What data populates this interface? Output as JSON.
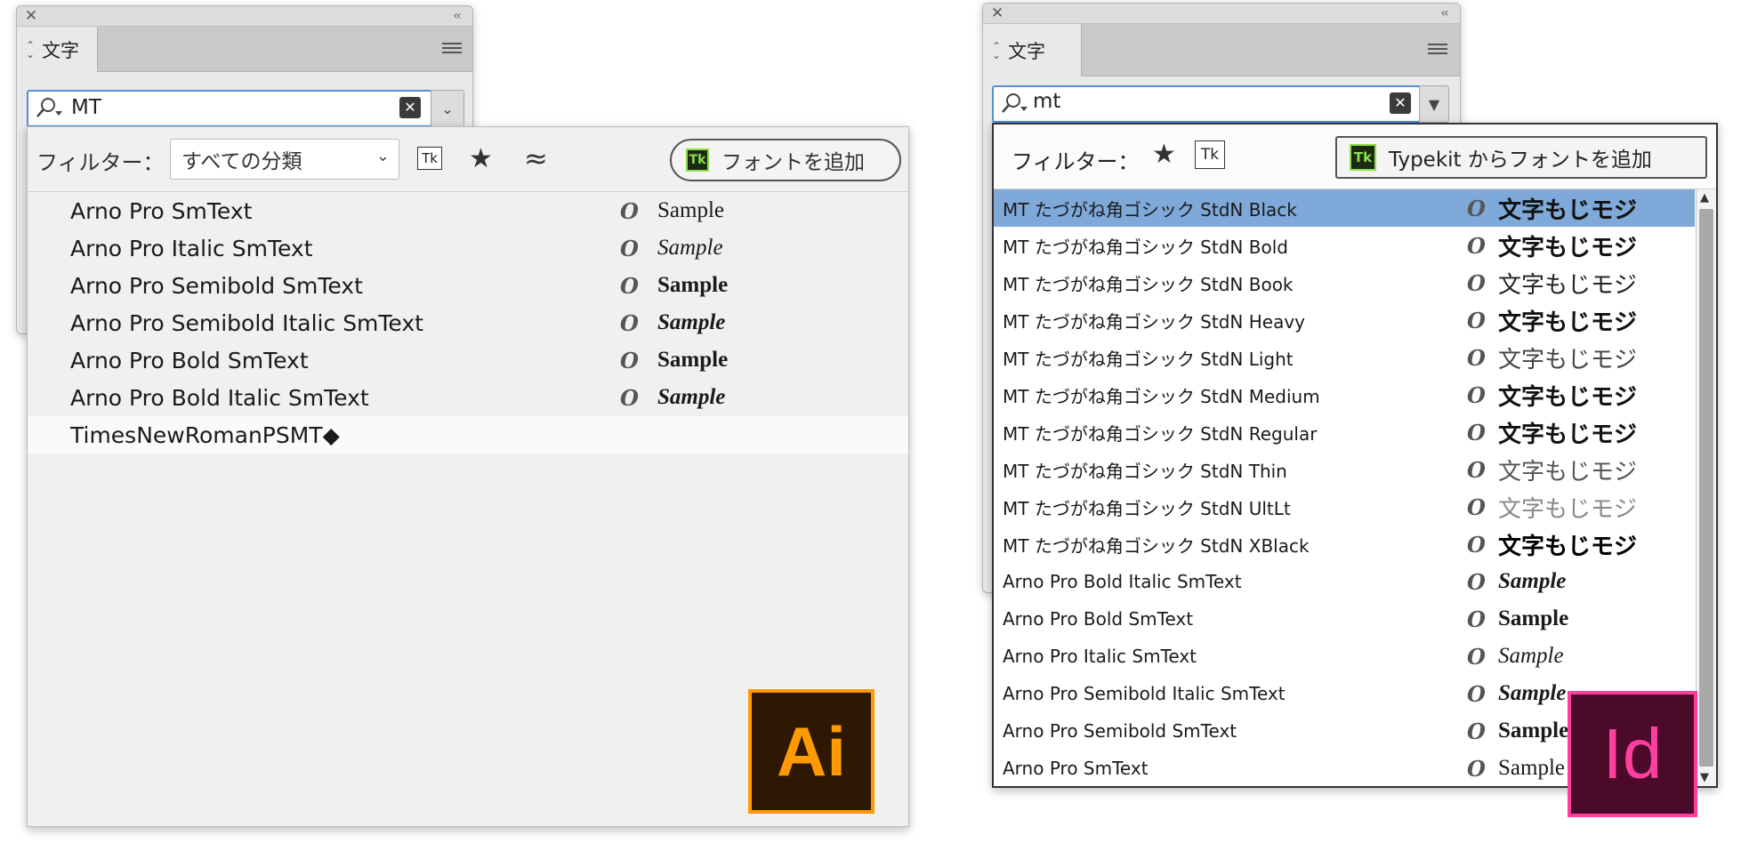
{
  "left_panel": {
    "tab_label": "文字",
    "search_value": "MT",
    "filter_label": "フィルター：",
    "classification_select": "すべての分類",
    "tk_label": "Tk",
    "add_font_button": "フォントを追加",
    "fonts": [
      {
        "name": "Arno Pro SmText",
        "sample": "Sample"
      },
      {
        "name": "Arno Pro Italic SmText",
        "sample": "Sample"
      },
      {
        "name": "Arno Pro Semibold SmText",
        "sample": "Sample"
      },
      {
        "name": "Arno Pro Semibold Italic SmText",
        "sample": "Sample"
      },
      {
        "name": "Arno Pro Bold SmText",
        "sample": "Sample"
      },
      {
        "name": "Arno Pro Bold Italic SmText",
        "sample": "Sample"
      },
      {
        "name": "TimesNewRomanPSMT◆",
        "sample": ""
      }
    ],
    "logo_text": "Ai",
    "logo_color": "#ff9a00"
  },
  "right_panel": {
    "tab_label": "文字",
    "search_value": "mt",
    "filter_label": "フィルター：",
    "tk_label": "Tk",
    "add_font_button": "Typekit からフォントを追加",
    "fonts": [
      {
        "name": "MT たづがね角ゴシック StdN Black",
        "sample": "文字もじモジ",
        "selected": true
      },
      {
        "name": "MT たづがね角ゴシック StdN Bold",
        "sample": "文字もじモジ"
      },
      {
        "name": "MT たづがね角ゴシック StdN Book",
        "sample": "文字もじモジ"
      },
      {
        "name": "MT たづがね角ゴシック StdN Heavy",
        "sample": "文字もじモジ"
      },
      {
        "name": "MT たづがね角ゴシック StdN Light",
        "sample": "文字もじモジ"
      },
      {
        "name": "MT たづがね角ゴシック StdN Medium",
        "sample": "文字もじモジ"
      },
      {
        "name": "MT たづがね角ゴシック StdN Regular",
        "sample": "文字もじモジ"
      },
      {
        "name": "MT たづがね角ゴシック StdN Thin",
        "sample": "文字もじモジ"
      },
      {
        "name": "MT たづがね角ゴシック StdN UltLt",
        "sample": "文字もじモジ"
      },
      {
        "name": "MT たづがね角ゴシック StdN XBlack",
        "sample": "文字もじモジ"
      },
      {
        "name": "Arno Pro Bold Italic SmText",
        "sample": "Sample"
      },
      {
        "name": "Arno Pro Bold SmText",
        "sample": "Sample"
      },
      {
        "name": "Arno Pro Italic SmText",
        "sample": "Sample"
      },
      {
        "name": "Arno Pro Semibold Italic SmText",
        "sample": "Sample"
      },
      {
        "name": "Arno Pro Semibold SmText",
        "sample": "Sample"
      },
      {
        "name": "Arno Pro SmText",
        "sample": "Sample"
      }
    ],
    "selected_row_color": "#7ea9d8",
    "logo_text": "Id",
    "logo_color": "#ff3fa0"
  },
  "font_type_glyph": "O"
}
